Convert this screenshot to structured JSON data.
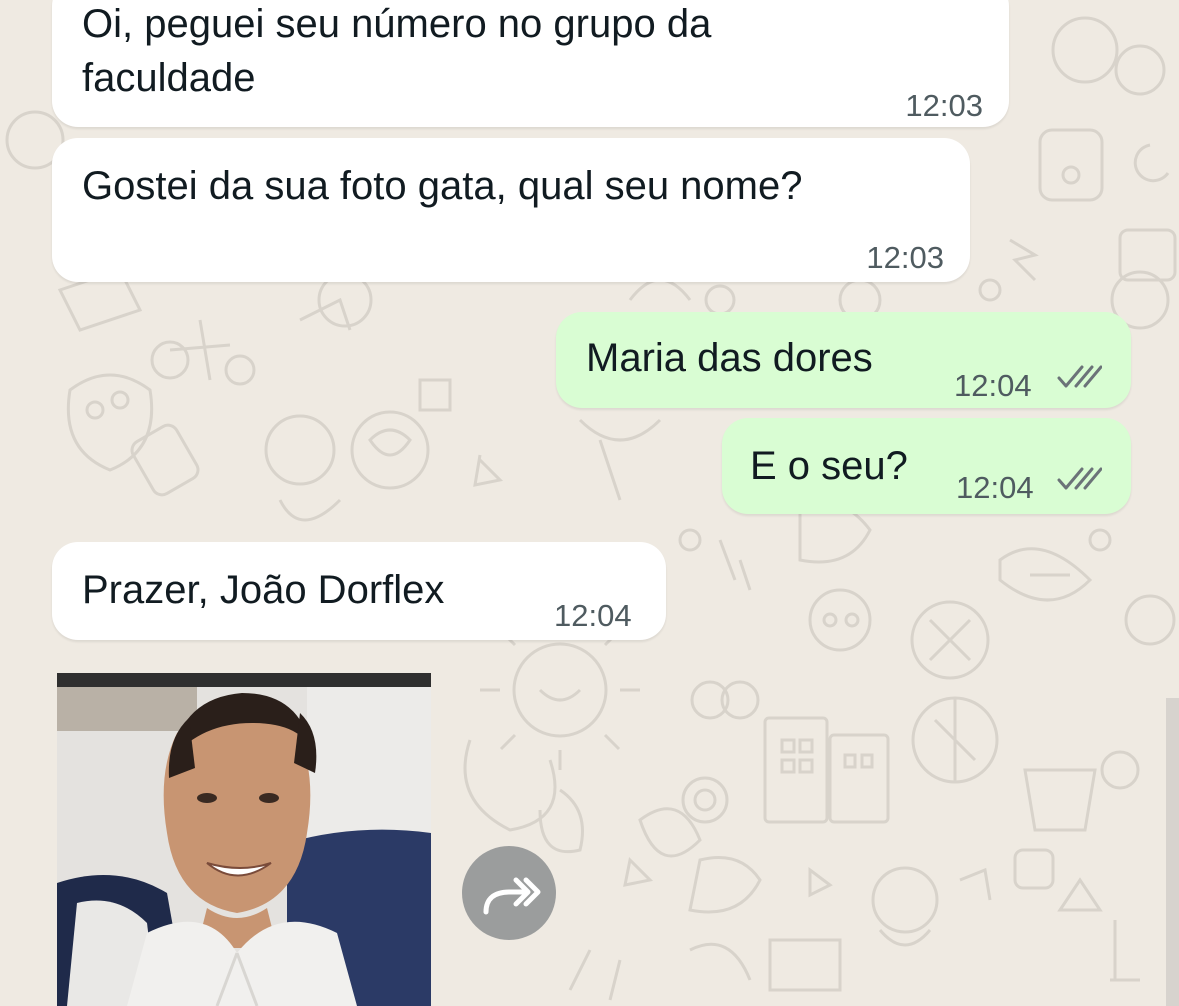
{
  "colors": {
    "wallpaper": "#efeae2",
    "incoming_bubble": "#ffffff",
    "outgoing_bubble": "#d9fdd3",
    "read_ticks": "#6b7378"
  },
  "messages": [
    {
      "direction": "incoming",
      "lines": [
        "Oi, peguei seu número no grupo da",
        "faculdade"
      ],
      "time": "12:03"
    },
    {
      "direction": "incoming",
      "lines": [
        "Gostei da sua foto gata, qual seu nome?"
      ],
      "time": "12:03"
    },
    {
      "direction": "outgoing",
      "lines": [
        "Maria das dores"
      ],
      "time": "12:04",
      "status_icon": "double-check-icon"
    },
    {
      "direction": "outgoing",
      "lines": [
        "E o seu?"
      ],
      "time": "12:04",
      "status_icon": "double-check-icon"
    },
    {
      "direction": "incoming",
      "lines": [
        "Prazer, João Dorflex"
      ],
      "time": "12:04"
    }
  ],
  "image_message": {
    "icon": "selfie-photo"
  },
  "forward_button": {
    "icon": "forward-arrow-icon"
  }
}
